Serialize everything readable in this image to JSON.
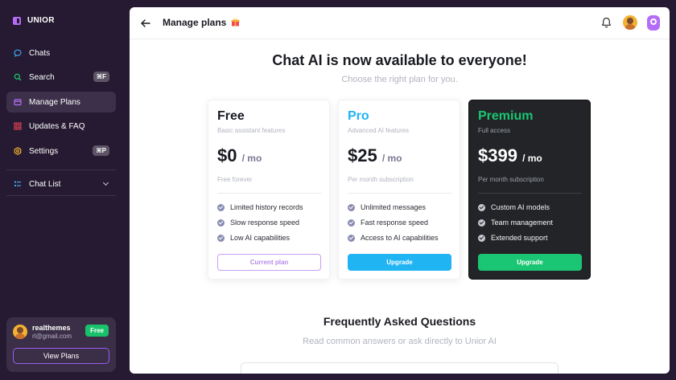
{
  "app": {
    "name": "UNIOR"
  },
  "sidebar": {
    "items": [
      {
        "label": "Chats",
        "icon": "chat-bubble-icon",
        "color": "#3aa6f5"
      },
      {
        "label": "Search",
        "icon": "search-icon",
        "color": "#19c26a",
        "shortcut": "⌘F"
      },
      {
        "label": "Manage Plans",
        "icon": "card-icon",
        "color": "#b56cf6",
        "active": true
      },
      {
        "label": "Updates & FAQ",
        "icon": "grid-icon",
        "color": "#f2455b"
      },
      {
        "label": "Settings",
        "icon": "gear-icon",
        "color": "#f3b233",
        "shortcut": "⌘P"
      }
    ],
    "chat_list": {
      "label": "Chat List",
      "icon": "list-icon",
      "color": "#3aa6f5"
    }
  },
  "user": {
    "name": "realthemes",
    "email": "rl@gmail.com",
    "plan_badge": "Free",
    "view_plans_label": "View Plans"
  },
  "header": {
    "title": "Manage plans",
    "gift_icon": "gift-icon"
  },
  "hero": {
    "title": "Chat AI is now available to everyone!",
    "subtitle": "Choose the right plan for you."
  },
  "plans": [
    {
      "name": "Free",
      "name_color": "#1a1b22",
      "desc": "Basic assistant features",
      "price": "$0",
      "per": "/ mo",
      "note": "Free forever",
      "features": [
        "Limited history records",
        "Slow response speed",
        "Low AI capabilities"
      ],
      "button": "Current plan"
    },
    {
      "name": "Pro",
      "name_color": "#20b4f2",
      "desc": "Advanced AI features",
      "price": "$25",
      "per": "/ mo",
      "note": "Per month subscription",
      "features": [
        "Unlimited messages",
        "Fast response speed",
        "Access to AI capabilities"
      ],
      "button": "Upgrade"
    },
    {
      "name": "Premium",
      "name_color": "#1ac673",
      "desc": "Full access",
      "price": "$399",
      "per": "/ mo",
      "note": "Per month subscription",
      "features": [
        "Custom AI models",
        "Team management",
        "Extended support"
      ],
      "button": "Upgrade"
    }
  ],
  "faq": {
    "title": "Frequently Asked Questions",
    "subtitle": "Read common answers or ask directly to Unior AI"
  }
}
